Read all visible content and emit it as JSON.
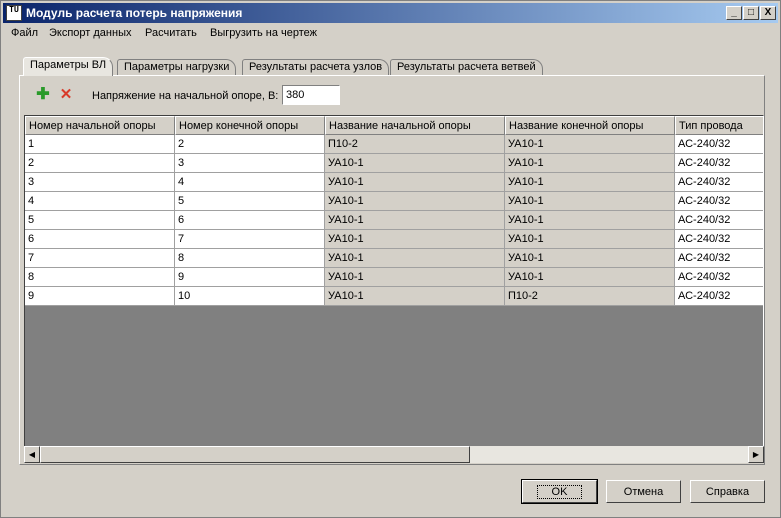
{
  "window": {
    "title": "Модуль расчета потерь напряжения",
    "icon_text": "TU",
    "controls": {
      "minimize": "_",
      "maximize": "□",
      "close": "X"
    }
  },
  "menu": [
    "Файл",
    "Экспорт данных",
    "Расчитать",
    "Выгрузить на чертеж"
  ],
  "tabs": [
    {
      "label": "Параметры ВЛ",
      "active": true
    },
    {
      "label": "Параметры нагрузки",
      "active": false
    },
    {
      "label": "Результаты расчета узлов",
      "active": false
    },
    {
      "label": "Результаты расчета ветвей",
      "active": false
    }
  ],
  "toolbar": {
    "add_icon": "plus-icon",
    "delete_icon": "x-icon"
  },
  "voltage": {
    "label": "Напряжение на начальной опоре, В:",
    "value": "380"
  },
  "grid": {
    "columns": [
      "Номер начальной опоры",
      "Номер конечной опоры",
      "Название начальной опоры",
      "Название конечной опоры",
      "Тип провода"
    ],
    "rows": [
      [
        "1",
        "2",
        "П10-2",
        "УА10-1",
        "АС-240/32"
      ],
      [
        "2",
        "3",
        "УА10-1",
        "УА10-1",
        "АС-240/32"
      ],
      [
        "3",
        "4",
        "УА10-1",
        "УА10-1",
        "АС-240/32"
      ],
      [
        "4",
        "5",
        "УА10-1",
        "УА10-1",
        "АС-240/32"
      ],
      [
        "5",
        "6",
        "УА10-1",
        "УА10-1",
        "АС-240/32"
      ],
      [
        "6",
        "7",
        "УА10-1",
        "УА10-1",
        "АС-240/32"
      ],
      [
        "7",
        "8",
        "УА10-1",
        "УА10-1",
        "АС-240/32"
      ],
      [
        "8",
        "9",
        "УА10-1",
        "УА10-1",
        "АС-240/32"
      ],
      [
        "9",
        "10",
        "УА10-1",
        "П10-2",
        "АС-240/32"
      ]
    ]
  },
  "buttons": {
    "ok": "OK",
    "cancel": "Отмена",
    "help": "Справка"
  },
  "colors": {
    "title_start": "#0a246a",
    "title_end": "#a6caf0",
    "add": "#2a9a2a",
    "delete": "#d83a2a"
  }
}
